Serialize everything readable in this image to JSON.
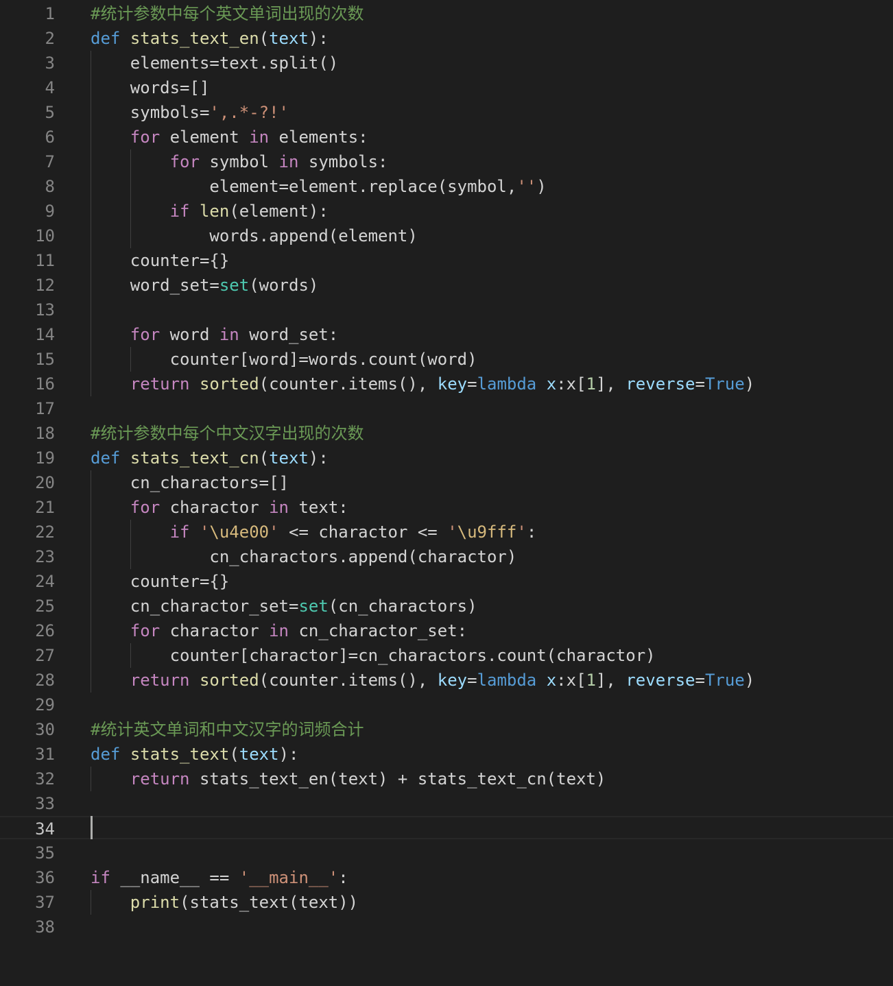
{
  "editor": {
    "language": "python",
    "current_line": 34,
    "colors": {
      "background": "#1e1e1e",
      "comment": "#6a9955",
      "keyword": "#569cd6",
      "control": "#c586c0",
      "function": "#dcdcaa",
      "parameter": "#9cdcfe",
      "string": "#ce9178",
      "escape": "#d7ba7d",
      "builtin_type": "#4ec9b0",
      "number": "#b5cea8",
      "line_number": "#858585"
    },
    "lines": [
      {
        "n": "1",
        "text": "#统计参数中每个英文单词出现的次数"
      },
      {
        "n": "2",
        "text": "def stats_text_en(text):"
      },
      {
        "n": "3",
        "text": "    elements=text.split()"
      },
      {
        "n": "4",
        "text": "    words=[]"
      },
      {
        "n": "5",
        "text": "    symbols=',.*-?!'"
      },
      {
        "n": "6",
        "text": "    for element in elements:"
      },
      {
        "n": "7",
        "text": "        for symbol in symbols:"
      },
      {
        "n": "8",
        "text": "            element=element.replace(symbol,'')"
      },
      {
        "n": "9",
        "text": "        if len(element):"
      },
      {
        "n": "10",
        "text": "            words.append(element)"
      },
      {
        "n": "11",
        "text": "    counter={}"
      },
      {
        "n": "12",
        "text": "    word_set=set(words)"
      },
      {
        "n": "13",
        "text": ""
      },
      {
        "n": "14",
        "text": "    for word in word_set:"
      },
      {
        "n": "15",
        "text": "        counter[word]=words.count(word)"
      },
      {
        "n": "16",
        "text": "    return sorted(counter.items(), key=lambda x:x[1], reverse=True)"
      },
      {
        "n": "17",
        "text": ""
      },
      {
        "n": "18",
        "text": "#统计参数中每个中文汉字出现的次数"
      },
      {
        "n": "19",
        "text": "def stats_text_cn(text):"
      },
      {
        "n": "20",
        "text": "    cn_charactors=[]"
      },
      {
        "n": "21",
        "text": "    for charactor in text:"
      },
      {
        "n": "22",
        "text": "        if '\\u4e00' <= charactor <= '\\u9fff':"
      },
      {
        "n": "23",
        "text": "            cn_charactors.append(charactor)"
      },
      {
        "n": "24",
        "text": "    counter={}"
      },
      {
        "n": "25",
        "text": "    cn_charactor_set=set(cn_charactors)"
      },
      {
        "n": "26",
        "text": "    for charactor in cn_charactor_set:"
      },
      {
        "n": "27",
        "text": "        counter[charactor]=cn_charactors.count(charactor)"
      },
      {
        "n": "28",
        "text": "    return sorted(counter.items(), key=lambda x:x[1], reverse=True)"
      },
      {
        "n": "29",
        "text": ""
      },
      {
        "n": "30",
        "text": "#统计英文单词和中文汉字的词频合计"
      },
      {
        "n": "31",
        "text": "def stats_text(text):"
      },
      {
        "n": "32",
        "text": "    return stats_text_en(text) + stats_text_cn(text)"
      },
      {
        "n": "33",
        "text": ""
      },
      {
        "n": "34",
        "text": ""
      },
      {
        "n": "35",
        "text": ""
      },
      {
        "n": "36",
        "text": "if __name__ == '__main__':"
      },
      {
        "n": "37",
        "text": "    print(stats_text(text))"
      },
      {
        "n": "38",
        "text": ""
      }
    ]
  }
}
